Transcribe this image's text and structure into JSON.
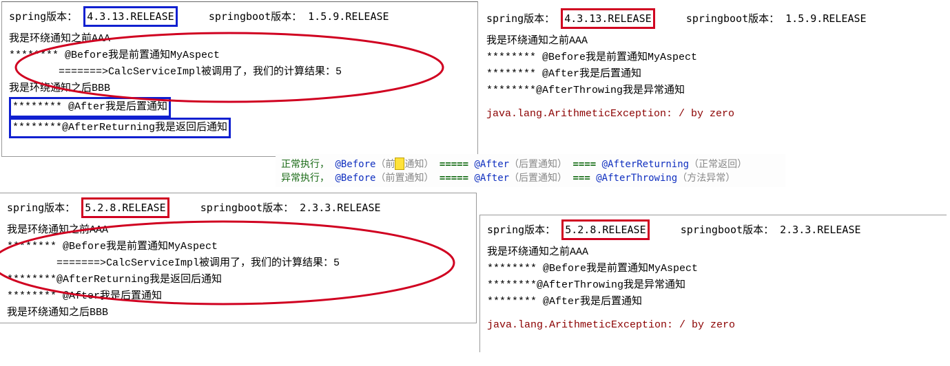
{
  "panels": {
    "tl": {
      "spring_label": "spring版本：",
      "spring_version": "4.3.13.RELEASE",
      "boot_label": "springboot版本：",
      "boot_version": "1.5.9.RELEASE",
      "lines": [
        "我是环绕通知之前AAA",
        "******** @Before我是前置通知MyAspect",
        "        =======>CalcServiceImpl被调用了，我们的计算结果：5",
        "我是环绕通知之后BBB",
        "******** @After我是后置通知",
        "********@AfterReturning我是返回后通知"
      ]
    },
    "tr": {
      "spring_label": "spring版本：",
      "spring_version": "4.3.13.RELEASE",
      "boot_label": "springboot版本：",
      "boot_version": "1.5.9.RELEASE",
      "lines": [
        "我是环绕通知之前AAA",
        "******** @Before我是前置通知MyAspect",
        "******** @After我是后置通知",
        "********@AfterThrowing我是异常通知"
      ],
      "exception": "java.lang.ArithmeticException: / by zero"
    },
    "bl": {
      "spring_label": "spring版本：",
      "spring_version": "5.2.8.RELEASE",
      "boot_label": "springboot版本：",
      "boot_version": "2.3.3.RELEASE",
      "lines": [
        "我是环绕通知之前AAA",
        "******** @Before我是前置通知MyAspect",
        "        =======>CalcServiceImpl被调用了，我们的计算结果：5",
        "********@AfterReturning我是返回后通知",
        "******** @After我是后置通知",
        "我是环绕通知之后BBB"
      ]
    },
    "br": {
      "spring_label": "spring版本：",
      "spring_version": "5.2.8.RELEASE",
      "boot_label": "springboot版本：",
      "boot_version": "2.3.3.RELEASE",
      "lines": [
        "我是环绕通知之前AAA",
        "******** @Before我是前置通知MyAspect",
        "********@AfterThrowing我是异常通知",
        "******** @After我是后置通知"
      ],
      "exception": "java.lang.ArithmeticException: / by zero"
    }
  },
  "summary": {
    "row1": {
      "label": "正常执行，",
      "seq": [
        {
          "t": "@Before",
          "p": "（前置通知）"
        },
        {
          "eq": "====="
        },
        {
          "t": "@After",
          "p": "（后置通知）"
        },
        {
          "eq": "===="
        },
        {
          "t": "@AfterReturning",
          "p": "（正常返回）"
        }
      ]
    },
    "row2": {
      "label": "异常执行，",
      "seq": [
        {
          "t": "@Before",
          "p": "（前置通知）"
        },
        {
          "eq": "====="
        },
        {
          "t": "@After",
          "p": "（后置通知）"
        },
        {
          "eq": "==="
        },
        {
          "t": "@AfterThrowing",
          "p": "（方法异常）"
        }
      ]
    }
  }
}
